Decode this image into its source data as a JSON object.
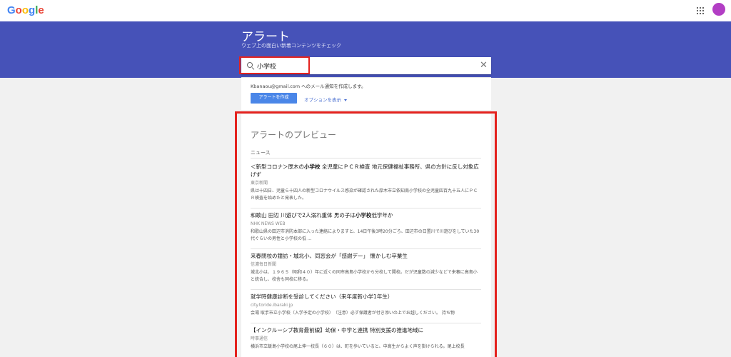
{
  "brand": {
    "logo": "Google"
  },
  "header": {
    "title": "アラート",
    "subtitle": "ウェブ上の面白い新着コンテンツをチェック"
  },
  "search": {
    "value": "小学校",
    "placeholder": ""
  },
  "settings": {
    "email_line": "Kbanaou@gmail.com へのメール通知を作成します。",
    "create_label": "アラートを作成",
    "options_label": "オプションを表示"
  },
  "preview": {
    "title": "アラートのプレビュー",
    "section": "ニュース",
    "items": [
      {
        "title_pre": "＜新型コロナ＞厚木の",
        "title_bold": "小学校",
        "title_post": " 全児童にＰＣＲ検査 地元保健福祉事務所、県の方針に反し対象広げず",
        "source": "東京新聞",
        "snippet": "県は十四日、児童ら十四人の新型コロナウイルス感染が確認された厚木市立依知南小学校の全児童四百九十五人にＰＣＲ検査を始めたと発表した。"
      },
      {
        "title_pre": "和歌山 田辺 川遊びで2人溺れ重体 男の子は",
        "title_bold": "小学校",
        "title_post": "低学年か",
        "source": "NHK NEWS WEB",
        "snippet": "和歌山県の田辺市消防本部に入った連絡によりますと、14日午後3時20分ごろ、田辺市の日置川で川遊びをしていた30代ぐらいの男性と小学校の低 ..."
      },
      {
        "title_pre": "来春閉校の鐘訪・城北小、同窓会が「感謝デー」 懐かしむ卒業生",
        "title_bold": "",
        "title_post": "",
        "source": "信濃毎日新聞",
        "snippet": "城北小は、１９６５（昭和４０）年に近くの同市高島小学校から分校して開校。だが児童数の減少などで来春に高島小と統合し、校舎も同校に移る。"
      },
      {
        "title_pre": "就学時健康診断を受診してください（来年度新小学1年生）",
        "title_bold": "",
        "title_post": "",
        "source": "city.toride.ibaraki.jp",
        "snippet": "会場 取手市立小学校（入学予定の小学校）　（注意）必ず保護者が付き添いの上でお越しください。 持ち物"
      },
      {
        "title_pre": "【インクルーシブ教育最前線】幼保・中学と連携 特別支援の推進地域に",
        "title_bold": "",
        "title_post": "",
        "source": "時事通信",
        "snippet": "横浜市立飯島小学校の尾上伸一校長（６０）は、町を歩いていると、中高生からよく声を掛けられる。尾上校長"
      }
    ]
  },
  "colors": {
    "banner": "#4652b8",
    "accent_blue": "#4a86e8",
    "highlight_red": "#e4221e",
    "avatar": "#b23ec4"
  },
  "icons": [
    "apps-grid-icon",
    "avatar",
    "search-icon",
    "close-icon",
    "caret-down-icon"
  ]
}
